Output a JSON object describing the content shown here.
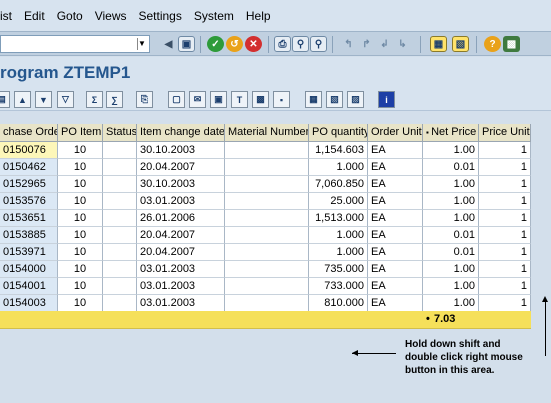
{
  "menu": {
    "items": [
      "ist",
      "Edit",
      "Goto",
      "Views",
      "Settings",
      "System",
      "Help"
    ]
  },
  "title": "rogram ZTEMP1",
  "table": {
    "headers": [
      "chase Order",
      "PO Item",
      "Status",
      "Item change date",
      "Material Number",
      "PO quantity",
      "Order Unit",
      "Net Price",
      "Price Unit"
    ],
    "rows": [
      [
        "0150076",
        "10",
        "",
        "30.10.2003",
        "",
        "1,154.603",
        "EA",
        "1.00",
        "1"
      ],
      [
        "0150462",
        "10",
        "",
        "20.04.2007",
        "",
        "1.000",
        "EA",
        "0.01",
        "1"
      ],
      [
        "0152965",
        "10",
        "",
        "30.10.2003",
        "",
        "7,060.850",
        "EA",
        "1.00",
        "1"
      ],
      [
        "0153576",
        "10",
        "",
        "03.01.2003",
        "",
        "25.000",
        "EA",
        "1.00",
        "1"
      ],
      [
        "0153651",
        "10",
        "",
        "26.01.2006",
        "",
        "1,513.000",
        "EA",
        "1.00",
        "1"
      ],
      [
        "0153885",
        "10",
        "",
        "20.04.2007",
        "",
        "1.000",
        "EA",
        "0.01",
        "1"
      ],
      [
        "0153971",
        "10",
        "",
        "20.04.2007",
        "",
        "1.000",
        "EA",
        "0.01",
        "1"
      ],
      [
        "0154000",
        "10",
        "",
        "03.01.2003",
        "",
        "735.000",
        "EA",
        "1.00",
        "1"
      ],
      [
        "0154001",
        "10",
        "",
        "03.01.2003",
        "",
        "733.000",
        "EA",
        "1.00",
        "1"
      ],
      [
        "0154003",
        "10",
        "",
        "03.01.2003",
        "",
        "810.000",
        "EA",
        "1.00",
        "1"
      ]
    ],
    "total_marker": "•",
    "net_price_total": "7.03"
  },
  "annotation": {
    "line1": "Hold down shift and",
    "line2": "double click right mouse",
    "line3": "button in this area."
  },
  "colors": {
    "title": "#25578e",
    "header_bg": "#e8e4c8",
    "key_column_bg": "#dbe8f5",
    "selected_cell_bg": "#fdf7b9",
    "total_row_bg": "#f5e05a"
  }
}
